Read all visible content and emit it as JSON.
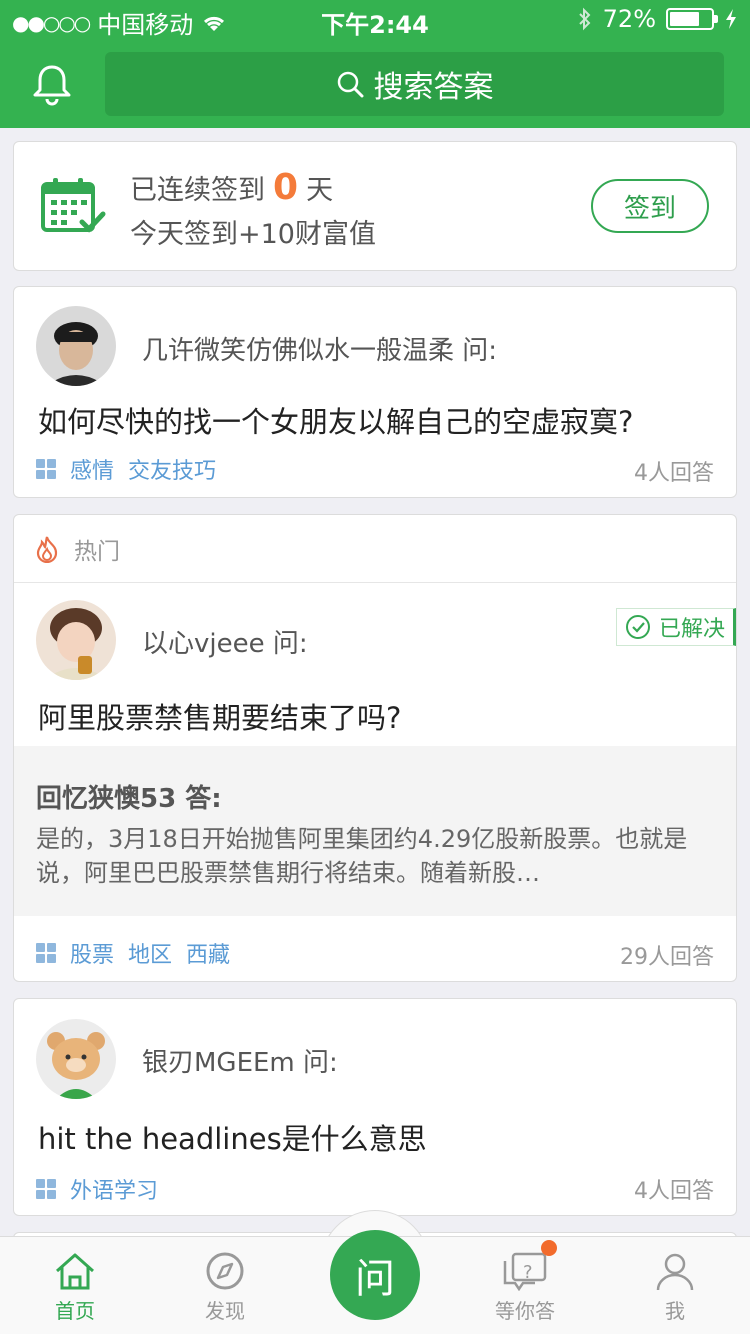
{
  "status_bar": {
    "carrier": "中国移动",
    "time": "下午2:44",
    "battery": "72%",
    "battery_level": 0.72
  },
  "header": {
    "search_label": "搜索答案"
  },
  "checkin": {
    "line1_prefix": "已连续签到",
    "days": "0",
    "line1_suffix": "天",
    "line2": "今天签到+10财富值",
    "button": "签到"
  },
  "questions": [
    {
      "asker": "几许微笑仿佛似水一般温柔 问:",
      "text": "如何尽快的找一个女朋友以解自己的空虚寂寞?",
      "tags": [
        "感情",
        "交友技巧"
      ],
      "answers": "4人回答"
    },
    {
      "section": "热门",
      "asker": "以心vjeee 问:",
      "badge": "已解决",
      "text": "阿里股票禁售期要结束了吗?",
      "answer_by": "回忆狭懊53 答:",
      "answer_text": "是的，3月18日开始抛售阿里集团约4.29亿股新股票。也就是说，阿里巴巴股票禁售期行将结束。随着新股…",
      "tags": [
        "股票",
        "地区",
        "西藏"
      ],
      "answers": "29人回答"
    },
    {
      "asker": "银刃MGEEm 问:",
      "text": "hit the headlines是什么意思",
      "tags": [
        "外语学习"
      ],
      "answers": "4人回答"
    }
  ],
  "tabbar": {
    "home": "首页",
    "discover": "发现",
    "ask": "问",
    "waiting": "等你答",
    "me": "我"
  },
  "colors": {
    "brand_green": "#34b250",
    "accent_orange": "#f47b3a",
    "tag_blue": "#5b9bd5"
  }
}
